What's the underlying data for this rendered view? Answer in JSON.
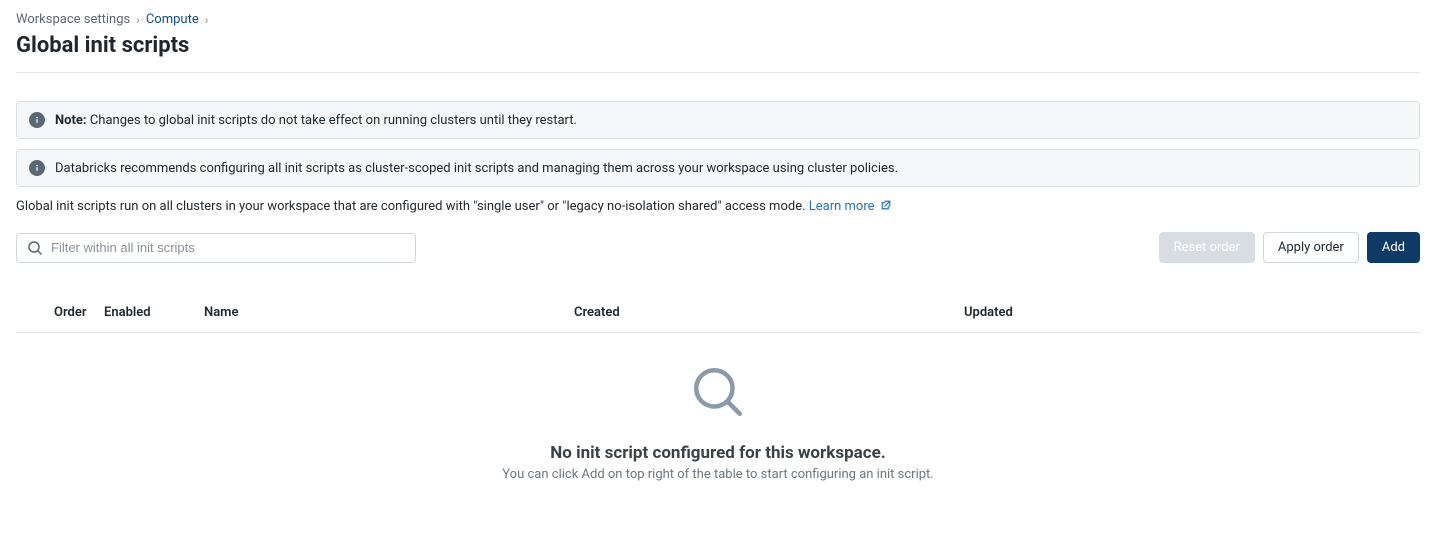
{
  "breadcrumb": {
    "workspace_settings": "Workspace settings",
    "compute": "Compute"
  },
  "page_title": "Global init scripts",
  "alerts": {
    "note_label": "Note:",
    "note_text": " Changes to global init scripts do not take effect on running clusters until they restart.",
    "recommend_text": "Databricks recommends configuring all init scripts as cluster-scoped init scripts and managing them across your workspace using cluster policies."
  },
  "description": {
    "text": "Global init scripts run on all clusters in your workspace that are configured with \"single user\" or \"legacy no-isolation shared\" access mode. ",
    "learn_more": "Learn more"
  },
  "search": {
    "placeholder": "Filter within all init scripts"
  },
  "buttons": {
    "reset_order": "Reset order",
    "apply_order": "Apply order",
    "add": "Add"
  },
  "table": {
    "columns": {
      "order": "Order",
      "enabled": "Enabled",
      "name": "Name",
      "created": "Created",
      "updated": "Updated"
    }
  },
  "empty": {
    "title": "No init script configured for this workspace.",
    "subtitle": "You can click Add on top right of the table to start configuring an init script."
  }
}
